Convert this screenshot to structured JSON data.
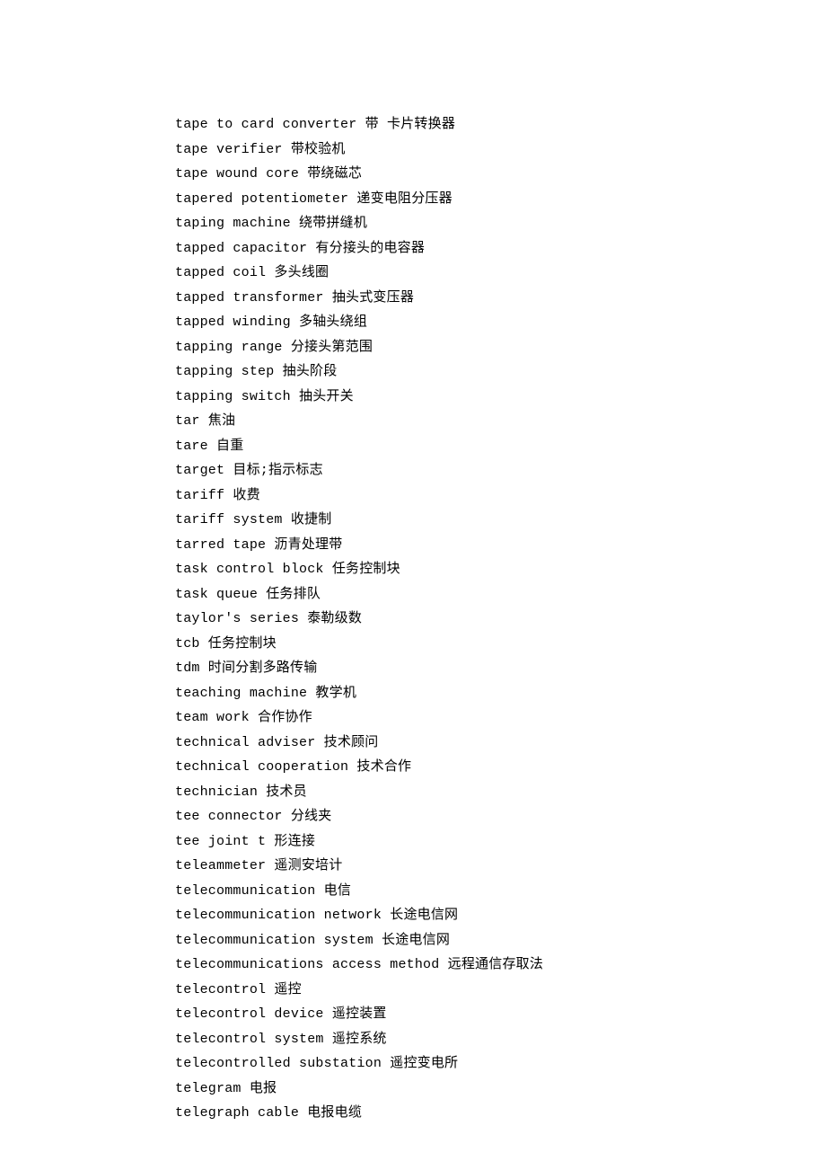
{
  "entries": [
    "tape to card converter 带 卡片转换器",
    "tape verifier 带校验机",
    "tape wound core 带绕磁芯",
    "tapered potentiometer 递变电阻分压器",
    "taping machine 绕带拼缝机",
    "tapped capacitor 有分接头的电容器",
    "tapped coil 多头线圈",
    "tapped transformer 抽头式变压器",
    "tapped winding 多轴头绕组",
    "tapping range 分接头第范围",
    "tapping step 抽头阶段",
    "tapping switch 抽头开关",
    "tar 焦油",
    "tare 自重",
    "target 目标;指示标志",
    "tariff 收费",
    "tariff system 收捷制",
    "tarred tape 沥青处理带",
    "task control block 任务控制块",
    "task queue 任务排队",
    "taylor's series 泰勒级数",
    "tcb 任务控制块",
    "tdm 时间分割多路传输",
    "teaching machine 教学机",
    "team work 合作协作",
    "technical adviser 技术顾问",
    "technical cooperation 技术合作",
    "technician 技术员",
    "tee connector 分线夹",
    "tee joint t 形连接",
    "teleammeter 遥测安培计",
    "telecommunication 电信",
    "telecommunication network 长途电信网",
    "telecommunication system 长途电信网",
    "telecommunications access method 远程通信存取法",
    "telecontrol 遥控",
    "telecontrol device 遥控装置",
    "telecontrol system 遥控系统",
    "telecontrolled substation 遥控变电所",
    "telegram 电报",
    "telegraph cable 电报电缆"
  ]
}
